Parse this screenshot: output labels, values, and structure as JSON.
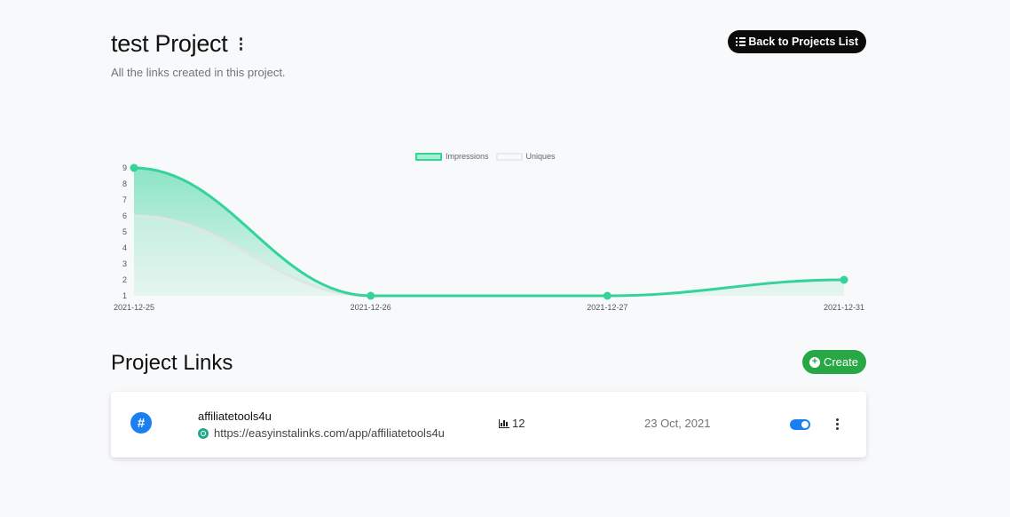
{
  "header": {
    "title": "test Project",
    "subtitle": "All the links created in this project.",
    "back_button_label": "Back to Projects List",
    "back_button_icon": "list-icon",
    "menu_icon": "kebab-icon"
  },
  "chart_data": {
    "type": "area",
    "categories": [
      "2021-12-25",
      "2021-12-26",
      "2021-12-27",
      "2021-12-31"
    ],
    "series": [
      {
        "name": "Impressions",
        "values": [
          9,
          1,
          1,
          2
        ],
        "color": "#34d399"
      },
      {
        "name": "Uniques",
        "values": [
          6,
          1,
          1,
          2
        ],
        "color": "#e8eaed"
      }
    ],
    "ylim": [
      1,
      9
    ],
    "yticks": [
      1,
      2,
      3,
      4,
      5,
      6,
      7,
      8,
      9
    ],
    "legend_position": "top-center",
    "grid": false
  },
  "links_section": {
    "title": "Project Links",
    "create_label": "Create",
    "create_icon": "plus-circle-icon"
  },
  "links": [
    {
      "name": "affiliatetools4u",
      "url": "https://easyinstalinks.com/app/affiliatetools4u",
      "clicks": "12",
      "date": "23 Oct, 2021",
      "enabled": true
    }
  ],
  "colors": {
    "accent_green": "#28a745",
    "chart_green": "#34d399",
    "toggle_blue": "#1b7ff2",
    "dark_button": "#0b0b0b"
  }
}
